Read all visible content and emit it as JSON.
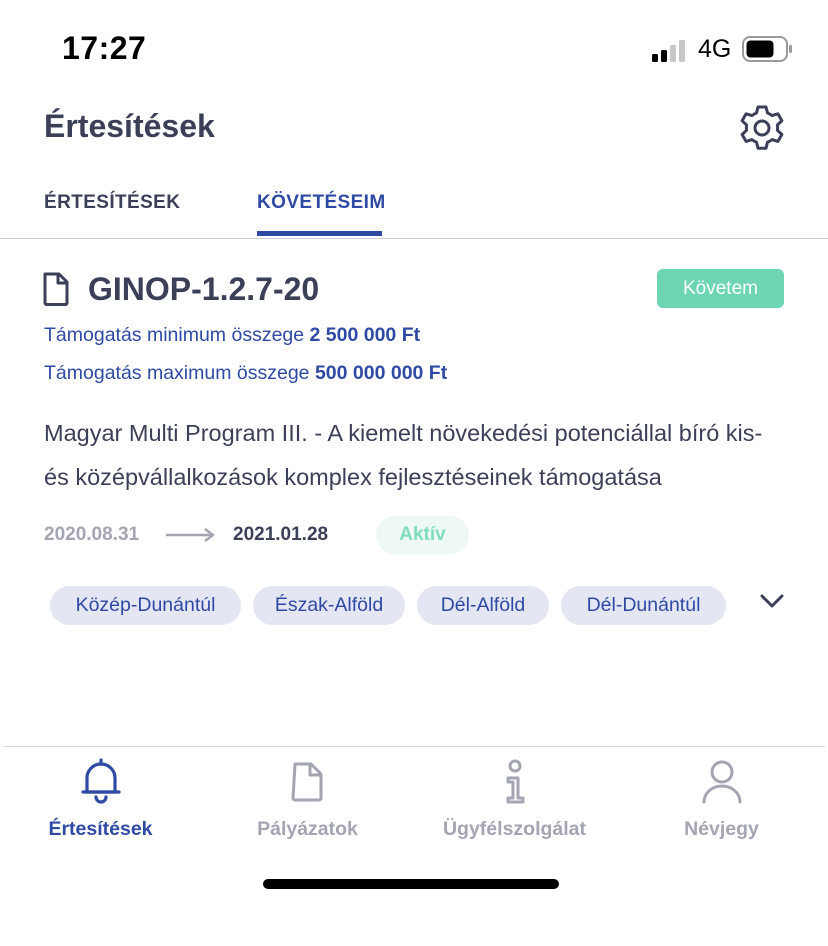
{
  "status_bar": {
    "time": "17:27",
    "network": "4G"
  },
  "header": {
    "title": "Értesítések",
    "settings_icon": "gear-icon"
  },
  "tabs": [
    {
      "label": "ÉRTESÍTÉSEK",
      "active": false
    },
    {
      "label": "KÖVETÉSEIM",
      "active": true
    }
  ],
  "card": {
    "icon": "document-icon",
    "title": "GINOP-1.2.7-20",
    "follow_label": "Követem",
    "min_label": "Támogatás minimum összege",
    "min_value": "2 500 000 Ft",
    "max_label": "Támogatás maximum összege",
    "max_value": "500 000 000 Ft",
    "description": "Magyar Multi Program III. - A kiemelt növekedési potenciállal bíró kis- és középvállalkozások komplex fejlesztéseinek támogatása",
    "start_date": "2020.08.31",
    "end_date": "2021.01.28",
    "status": "Aktív",
    "tags": [
      "Közép-Dunántúl",
      "Észak-Alföld",
      "Dél-Alföld",
      "Dél-Dunántúl"
    ],
    "expand_icon": "chevron-down-icon"
  },
  "bottom_nav": [
    {
      "label": "Értesítések",
      "icon": "bell-icon",
      "active": true
    },
    {
      "label": "Pályázatok",
      "icon": "document-icon",
      "active": false
    },
    {
      "label": "Ügyfélszolgálat",
      "icon": "info-icon",
      "active": false
    },
    {
      "label": "Névjegy",
      "icon": "user-icon",
      "active": false
    }
  ],
  "colors": {
    "primary": "#2f4aa4",
    "text": "#3c3f58",
    "muted": "#a3a5b2",
    "accent_green": "#6dd4b4",
    "tag_bg": "#e4e6f3"
  }
}
